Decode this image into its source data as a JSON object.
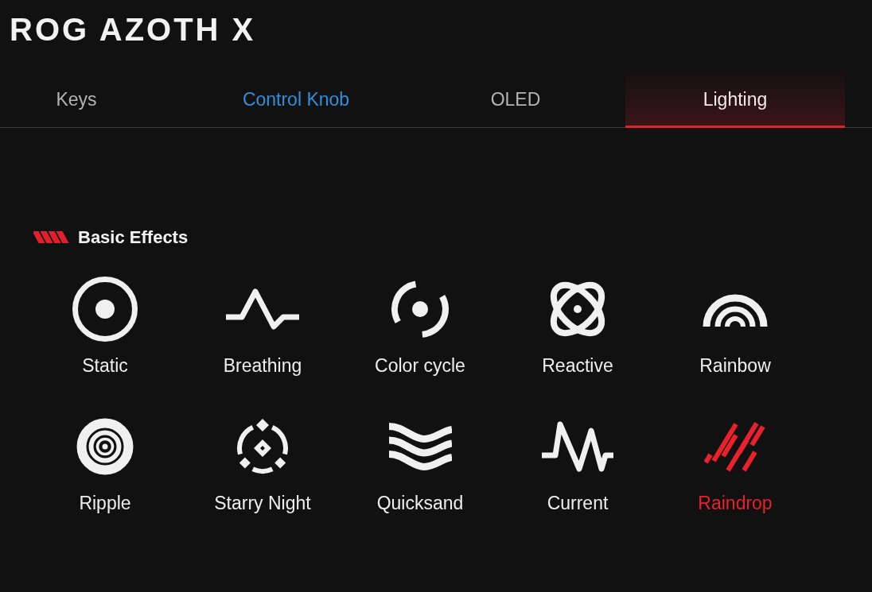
{
  "title": "ROG AZOTH X",
  "tabs": [
    {
      "label": "Keys",
      "selected": false,
      "hovered": false
    },
    {
      "label": "Control Knob",
      "selected": false,
      "hovered": true
    },
    {
      "label": "OLED",
      "selected": false,
      "hovered": false
    },
    {
      "label": "Lighting",
      "selected": true,
      "hovered": false
    }
  ],
  "section": {
    "heading": "Basic Effects",
    "effects": [
      {
        "label": "Static",
        "selected": false
      },
      {
        "label": "Breathing",
        "selected": false
      },
      {
        "label": "Color cycle",
        "selected": false
      },
      {
        "label": "Reactive",
        "selected": false
      },
      {
        "label": "Rainbow",
        "selected": false
      },
      {
        "label": "Ripple",
        "selected": false
      },
      {
        "label": "Starry Night",
        "selected": false
      },
      {
        "label": "Quicksand",
        "selected": false
      },
      {
        "label": "Current",
        "selected": false
      },
      {
        "label": "Raindrop",
        "selected": true
      }
    ]
  }
}
